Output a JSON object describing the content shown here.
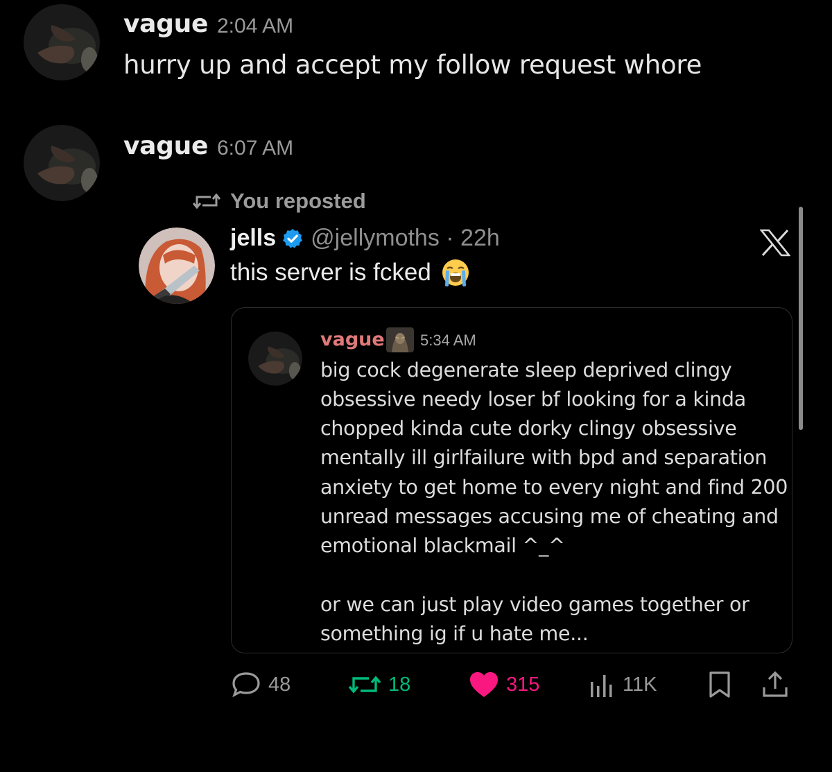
{
  "messages": [
    {
      "author": "vague",
      "time": "2:04 AM",
      "text": "hurry up and accept my follow request whore"
    },
    {
      "author": "vague",
      "time": "6:07 AM"
    }
  ],
  "repost": {
    "label": "You reposted",
    "tweet": {
      "author": "jells",
      "handle_time": "@jellymoths · 22h",
      "text": "this server is fcked",
      "emoji": "😭",
      "embed": {
        "author": "vague",
        "time": "5:34 AM",
        "lines": [
          "big cock degenerate sleep deprived clingy",
          "obsessive needy loser bf looking for a kinda",
          "chopped kinda cute dorky clingy obsessive",
          "mentally ill girlfailure with bpd and separation",
          "anxiety to get home to every night and find 200",
          "unread messages accusing me of cheating and",
          "emotional blackmail ^_^",
          "",
          "or we can just play video games together or",
          "something ig if u hate me..."
        ]
      },
      "stats": {
        "replies": "48",
        "reposts": "18",
        "likes": "315",
        "views": "11K"
      }
    }
  },
  "colors": {
    "background": "#000000",
    "repost_green": "#00ba7c",
    "like_pink": "#f91880",
    "verified_blue": "#1d9bf0",
    "embed_name": "#e07a7a"
  }
}
